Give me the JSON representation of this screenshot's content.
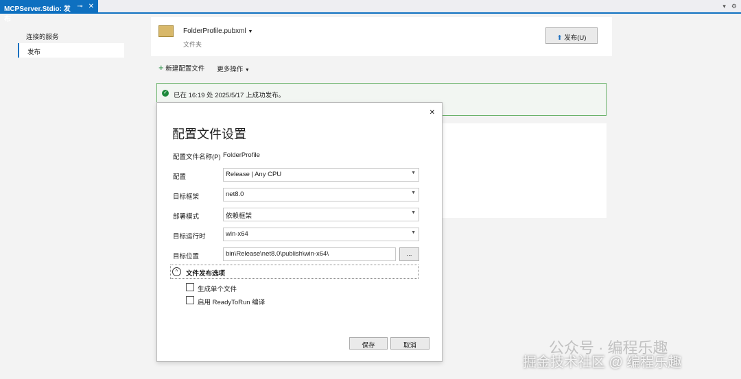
{
  "tab": {
    "title": "MCPServer.Stdio: 发布",
    "pin": "⊸",
    "close": "✕"
  },
  "window_icons": {
    "dropdown": "▾",
    "settings": "⚙"
  },
  "sidebar": {
    "items": [
      {
        "label": "连接的服务"
      },
      {
        "label": "发布"
      }
    ]
  },
  "profile": {
    "name": "FolderProfile.pubxml",
    "type": "文件夹",
    "publish_button": "发布(U)"
  },
  "toolbar": {
    "new_profile": "新建配置文件",
    "more_actions": "更多操作"
  },
  "banner": {
    "message": "已在 16:19 处 2025/5/17 上成功发布。"
  },
  "dialog": {
    "title": "配置文件设置",
    "close": "✕",
    "profile_name_label": "配置文件名称(P)",
    "profile_name_value": "FolderProfile",
    "fields": [
      {
        "label": "配置",
        "value": "Release | Any CPU"
      },
      {
        "label": "目标框架",
        "value": "net8.0"
      },
      {
        "label": "部署模式",
        "value": "依赖框架"
      },
      {
        "label": "目标运行时",
        "value": "win-x64"
      }
    ],
    "target_location_label": "目标位置",
    "target_location_value": "bin\\Release\\net8.0\\publish\\win-x64\\",
    "browse_button": "...",
    "section_title": "文件发布选项",
    "options": [
      {
        "label": "生成单个文件",
        "checked": false
      },
      {
        "label": "启用 ReadyToRun 编译",
        "checked": false
      }
    ],
    "save_button": "保存",
    "cancel_button": "取消"
  },
  "watermark": {
    "line1": "公众号 · 编程乐趣",
    "line2": "掘金技术社区 @ 编程乐趣"
  }
}
